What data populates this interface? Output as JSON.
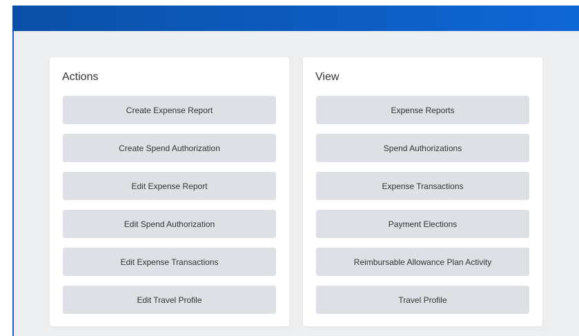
{
  "actions": {
    "title": "Actions",
    "buttons": [
      "Create Expense Report",
      "Create Spend Authorization",
      "Edit Expense Report",
      "Edit Spend Authorization",
      "Edit Expense Transactions",
      "Edit Travel Profile"
    ]
  },
  "view": {
    "title": "View",
    "buttons": [
      "Expense Reports",
      "Spend Authorizations",
      "Expense Transactions",
      "Payment Elections",
      "Reimbursable Allowance Plan Activity",
      "Travel Profile"
    ]
  },
  "colors": {
    "header_blue": "#0d5cc0",
    "background": "#edeeef",
    "card": "#ffffff",
    "button": "#dde1e5",
    "text": "#333333"
  }
}
